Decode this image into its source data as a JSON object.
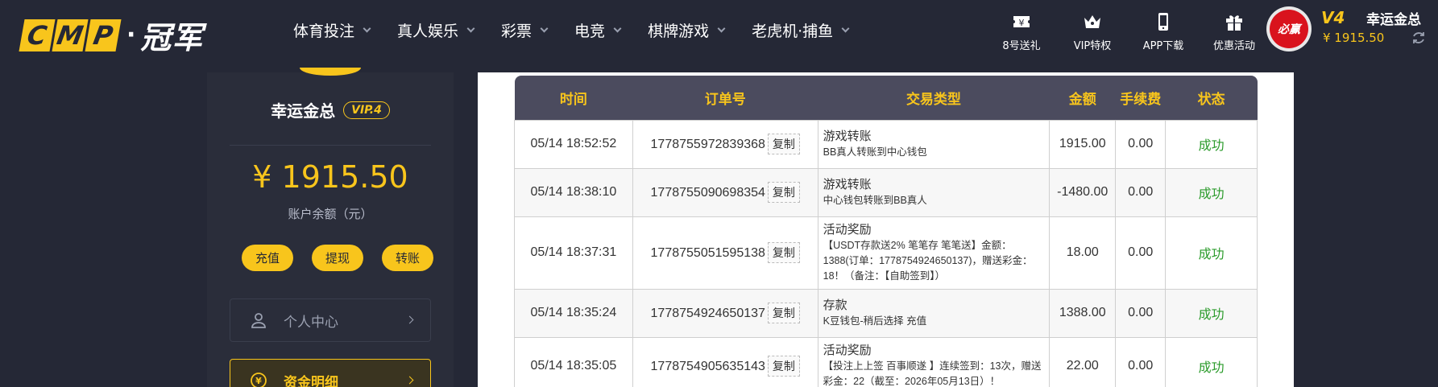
{
  "header": {
    "logo_letters": [
      "C",
      "M",
      "P"
    ],
    "logo_dot": "·",
    "logo_cn": "冠军",
    "nav": [
      {
        "label": "体育投注"
      },
      {
        "label": "真人娱乐"
      },
      {
        "label": "彩票"
      },
      {
        "label": "电竞"
      },
      {
        "label": "棋牌游戏"
      },
      {
        "label": "老虎机·捕鱼"
      }
    ],
    "quick": [
      {
        "label": "8号送礼",
        "icon": "ticket-icon"
      },
      {
        "label": "VIP特权",
        "icon": "crown-icon"
      },
      {
        "label": "APP下载",
        "icon": "phone-icon"
      },
      {
        "label": "优惠活动",
        "icon": "gift-icon"
      }
    ],
    "avatar_text": "必赢",
    "vip_level": "V4",
    "username": "幸运金总",
    "balance": "¥ 1915.50"
  },
  "sidebar": {
    "username": "幸运金总",
    "vip_badge": "VIP.4",
    "balance": "¥ 1915.50",
    "balance_label": "账户余额（元）",
    "buttons": [
      "充值",
      "提现",
      "转账"
    ],
    "menu": [
      {
        "label": "个人中心"
      },
      {
        "label": "资金明细"
      }
    ]
  },
  "table": {
    "headers": [
      "时间",
      "订单号",
      "交易类型",
      "金额",
      "手续费",
      "状态"
    ],
    "copy_label": "复制",
    "rows": [
      {
        "time": "05/14 18:52:52",
        "order": "1778755972839368",
        "type_title": "游戏转账",
        "type_desc": "BB真人转账到中心钱包",
        "amount": "1915.00",
        "fee": "0.00",
        "status": "成功"
      },
      {
        "time": "05/14 18:38:10",
        "order": "1778755090698354",
        "type_title": "游戏转账",
        "type_desc": "中心钱包转账到BB真人",
        "amount": "-1480.00",
        "fee": "0.00",
        "status": "成功"
      },
      {
        "time": "05/14 18:37:31",
        "order": "1778755051595138",
        "type_title": "活动奖励",
        "type_desc": "【USDT存款送2% 笔笔存 笔笔送】金额：1388(订单：1778754924650137)，赠送彩金：18！（备注：【自助签到】）",
        "amount": "18.00",
        "fee": "0.00",
        "status": "成功"
      },
      {
        "time": "05/14 18:35:24",
        "order": "1778754924650137",
        "type_title": "存款",
        "type_desc": "K豆钱包-稍后选择 充值",
        "amount": "1388.00",
        "fee": "0.00",
        "status": "成功"
      },
      {
        "time": "05/14 18:35:05",
        "order": "1778754905635143",
        "type_title": "活动奖励",
        "type_desc": "【投注上上签 百事顺遂 】连续签到：13次，赠送彩金：22（截至：2026年05月13日）！",
        "amount": "22.00",
        "fee": "0.00",
        "status": "成功"
      }
    ]
  },
  "colors": {
    "accent": "#f8c51c",
    "background": "#252836",
    "success": "#2b9b2b"
  }
}
